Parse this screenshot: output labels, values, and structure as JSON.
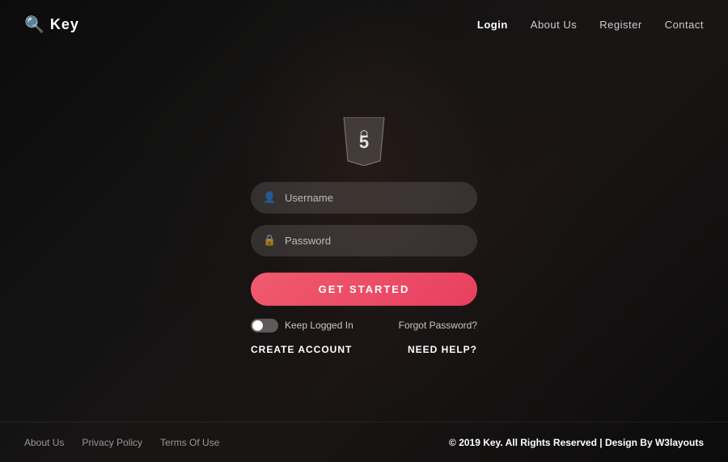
{
  "logo": {
    "text": "Key",
    "icon": "🔍"
  },
  "nav": {
    "items": [
      {
        "label": "Login",
        "active": true
      },
      {
        "label": "About Us",
        "active": false
      },
      {
        "label": "Register",
        "active": false
      },
      {
        "label": "Contact",
        "active": false
      }
    ]
  },
  "form": {
    "username_placeholder": "Username",
    "password_placeholder": "Password",
    "submit_label": "GET STARTED",
    "keep_logged_label": "Keep Logged In",
    "forgot_label": "Forgot Password?",
    "create_account_label": "CREATE ACCOUNT",
    "need_help_label": "NEED HELP?"
  },
  "footer": {
    "links": [
      {
        "label": "About Us"
      },
      {
        "label": "Privacy Policy"
      },
      {
        "label": "Terms Of Use"
      }
    ],
    "copyright": "© 2019 Key. All Rights Reserved | Design By ",
    "brand": "W3layouts"
  }
}
